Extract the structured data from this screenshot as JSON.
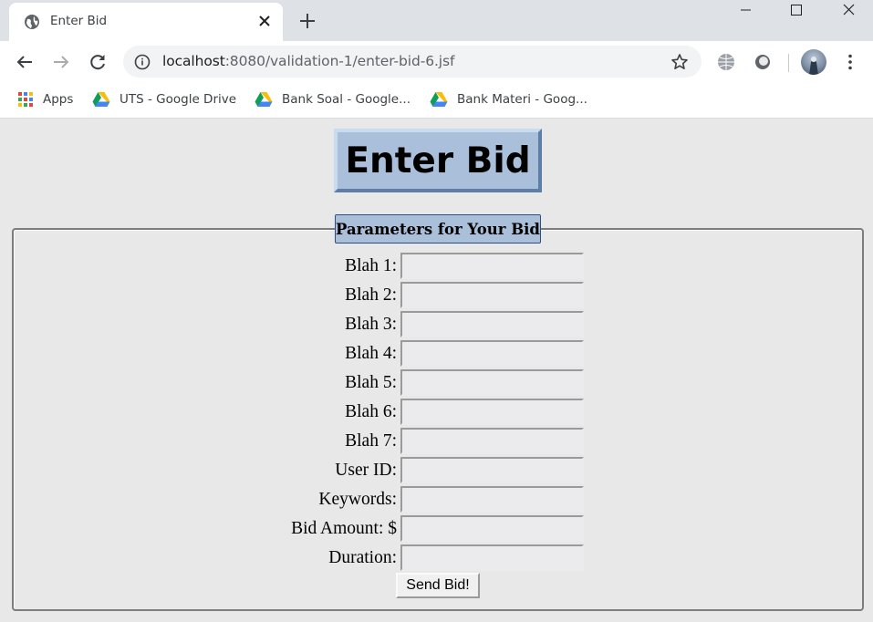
{
  "browser": {
    "tab_title": "Enter Bid",
    "url_host": "localhost",
    "url_rest": ":8080/validation-1/enter-bid-6.jsf",
    "bookmarks": [
      {
        "label": "Apps",
        "icon": "apps-grid-icon"
      },
      {
        "label": "UTS - Google Drive",
        "icon": "google-drive-icon"
      },
      {
        "label": "Bank Soal - Google...",
        "icon": "google-drive-icon"
      },
      {
        "label": "Bank Materi - Goog...",
        "icon": "google-drive-icon"
      }
    ]
  },
  "page": {
    "title": "Enter Bid",
    "legend": "Parameters for Your Bid",
    "fields": [
      {
        "label": "Blah 1:",
        "value": ""
      },
      {
        "label": "Blah 2:",
        "value": ""
      },
      {
        "label": "Blah 3:",
        "value": ""
      },
      {
        "label": "Blah 4:",
        "value": ""
      },
      {
        "label": "Blah 5:",
        "value": ""
      },
      {
        "label": "Blah 6:",
        "value": ""
      },
      {
        "label": "Blah 7:",
        "value": ""
      },
      {
        "label": "User ID:",
        "value": ""
      },
      {
        "label": "Keywords:",
        "value": ""
      },
      {
        "label": "Bid Amount: $",
        "value": ""
      },
      {
        "label": "Duration:",
        "value": ""
      }
    ],
    "submit_label": "Send Bid!"
  },
  "colors": {
    "title_bg": "#aabfd9",
    "page_bg": "#e8e8e8",
    "legend_border": "#2d4f86"
  }
}
